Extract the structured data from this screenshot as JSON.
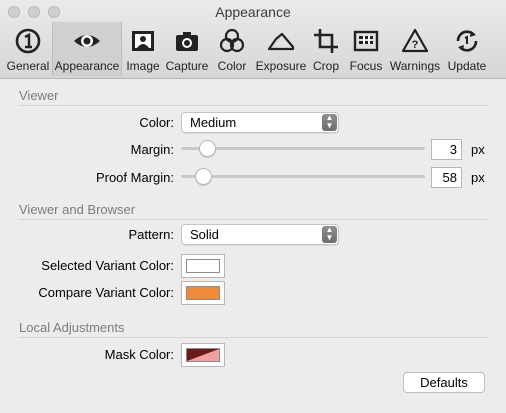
{
  "window": {
    "title": "Appearance"
  },
  "toolbar": {
    "items": [
      {
        "label": "General",
        "icon": "info-circle-icon"
      },
      {
        "label": "Appearance",
        "icon": "eye-icon",
        "selected": true
      },
      {
        "label": "Image",
        "icon": "portrait-image-icon"
      },
      {
        "label": "Capture",
        "icon": "camera-icon"
      },
      {
        "label": "Color",
        "icon": "color-circles-icon"
      },
      {
        "label": "Exposure",
        "icon": "exposure-curve-icon"
      },
      {
        "label": "Crop",
        "icon": "crop-icon"
      },
      {
        "label": "Focus",
        "icon": "focus-grid-icon"
      },
      {
        "label": "Warnings",
        "icon": "warning-triangle-icon"
      },
      {
        "label": "Update",
        "icon": "update-arrows-icon"
      }
    ]
  },
  "viewer": {
    "section_title": "Viewer",
    "color_label": "Color:",
    "color_value": "Medium",
    "margin_label": "Margin:",
    "margin_value": "3",
    "margin_unit": "px",
    "margin_slider_level": 0.08,
    "proof_margin_label": "Proof Margin:",
    "proof_margin_value": "58",
    "proof_margin_unit": "px",
    "proof_margin_slider_level": 0.06
  },
  "browser": {
    "section_title": "Viewer and Browser",
    "pattern_label": "Pattern:",
    "pattern_value": "Solid",
    "selected_variant_label": "Selected Variant Color:",
    "selected_variant_color": "#ffffff",
    "compare_variant_label": "Compare Variant Color:",
    "compare_variant_color": "#ef8a3a"
  },
  "local": {
    "section_title": "Local Adjustments",
    "mask_label": "Mask Color:",
    "mask_color_dark": "#6e1a1a",
    "mask_color_light": "#f0a0a0"
  },
  "footer": {
    "defaults_label": "Defaults"
  }
}
